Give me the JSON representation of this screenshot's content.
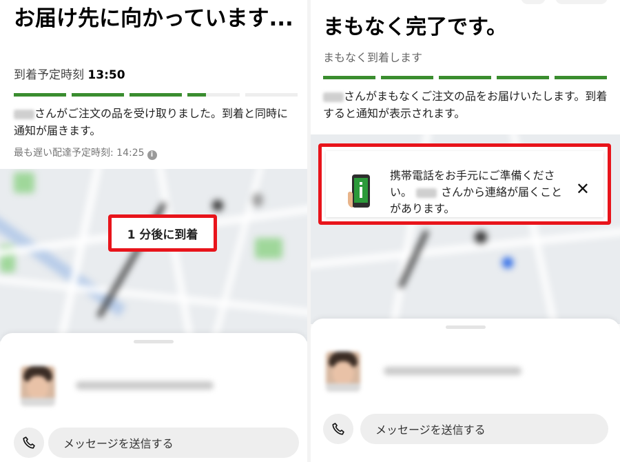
{
  "left": {
    "title": "お届け先に向かっています...",
    "eta_label": "到着予定時刻 ",
    "eta_time": "13:50",
    "progress": [
      1,
      1,
      1,
      0.35,
      0
    ],
    "msg_after_name": "さんがご注文の品を受け取りました。到着と同時に通知が届きます。",
    "latest_label": "最も遅い配達予定時刻: 14:25",
    "map_chip": "1 分後に到着",
    "message_button": "メッセージを送信する"
  },
  "right": {
    "title": "まもなく完了です。",
    "subtitle": "まもなく到着します",
    "progress": [
      1,
      1,
      1,
      1,
      1
    ],
    "msg_after_name": "さんがまもなくご注文の品をお届けいたします。到着すると通知が表示されます。",
    "notice_part1": "携帯電話をお手元にご準備ください。",
    "notice_part2": "さんから連絡が届くことがあります。",
    "close_glyph": "✕",
    "message_button": "メッセージを送信する"
  },
  "colors": {
    "progress_green": "#3a8d2f",
    "highlight_red": "#e8141b"
  },
  "icons": [
    "info-icon",
    "phone-call-icon",
    "smartphone-info-icon",
    "close-icon",
    "location-pin-icon"
  ]
}
